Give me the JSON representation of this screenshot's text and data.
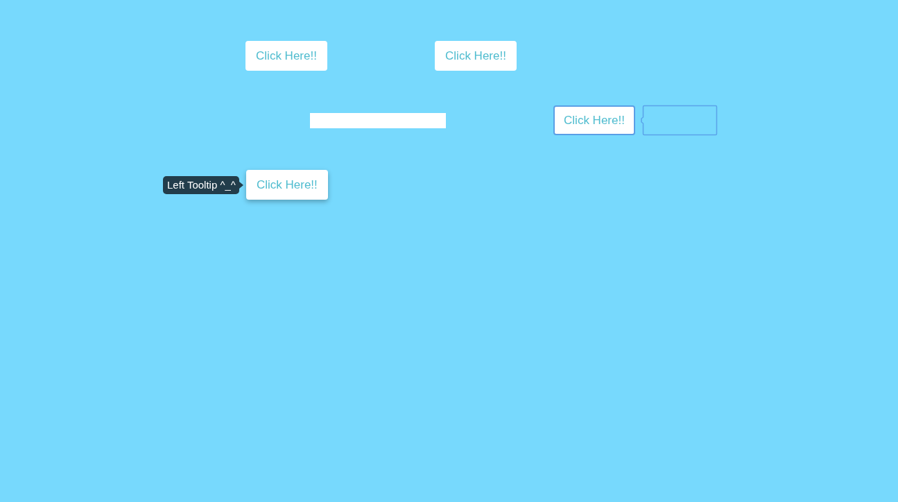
{
  "rows": [
    {
      "items": [
        {
          "kind": "button",
          "label": "Click Here!!",
          "focused": false,
          "hovered": false
        },
        {
          "kind": "button",
          "label": "Click Here!!",
          "focused": false,
          "hovered": false
        }
      ]
    },
    {
      "items": [
        {
          "kind": "bar"
        },
        {
          "kind": "button",
          "label": "Click Here!!",
          "focused": true,
          "hovered": false
        },
        {
          "kind": "tooltip-outline"
        }
      ]
    },
    {
      "items": [
        {
          "kind": "tooltip",
          "text": "Left Tooltip ^_^"
        },
        {
          "kind": "button",
          "label": "Click Here!!",
          "focused": false,
          "hovered": true
        }
      ]
    }
  ]
}
